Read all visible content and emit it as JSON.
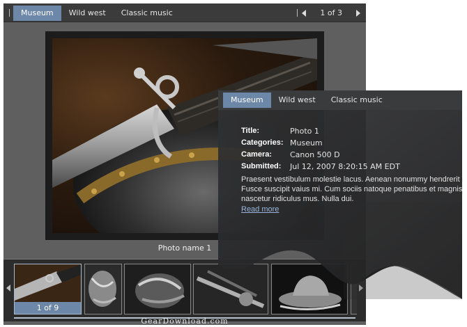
{
  "gallery": {
    "tabs": [
      {
        "label": "Museum",
        "active": true
      },
      {
        "label": "Wild west",
        "active": false
      },
      {
        "label": "Classic music",
        "active": false
      }
    ],
    "pager": {
      "count": "1 of 3"
    },
    "photo_caption": "Photo name 1",
    "thumb_counter": "1 of 9",
    "watermark": "GearDownload.com"
  },
  "panel": {
    "tabs": [
      {
        "label": "Museum",
        "active": true
      },
      {
        "label": "Wild west",
        "active": false
      },
      {
        "label": "Classic music",
        "active": false
      }
    ],
    "fields": [
      {
        "key": "Title:",
        "value": "Photo 1"
      },
      {
        "key": "Categories:",
        "value": "Museum"
      },
      {
        "key": "Camera:",
        "value": "Canon 500 D"
      },
      {
        "key": "Submitted:",
        "value": "Jul 12, 2007 8:20:15 AM EDT"
      }
    ],
    "description": [
      "Praesent vestibulum molestie lacus. Aenean nonummy hendrerit m",
      "Fusce suscipit vaius mi. Cum sociis natoque penatibus et magnis d",
      "nascetur ridiculus mus. Nulla dui."
    ],
    "read_more": "Read more"
  },
  "colors": {
    "accent": "#6d87a8",
    "bar": "#3b3b3b",
    "panel": "#2f3032"
  },
  "icons": [
    "arrow-left-icon",
    "arrow-right-icon"
  ]
}
